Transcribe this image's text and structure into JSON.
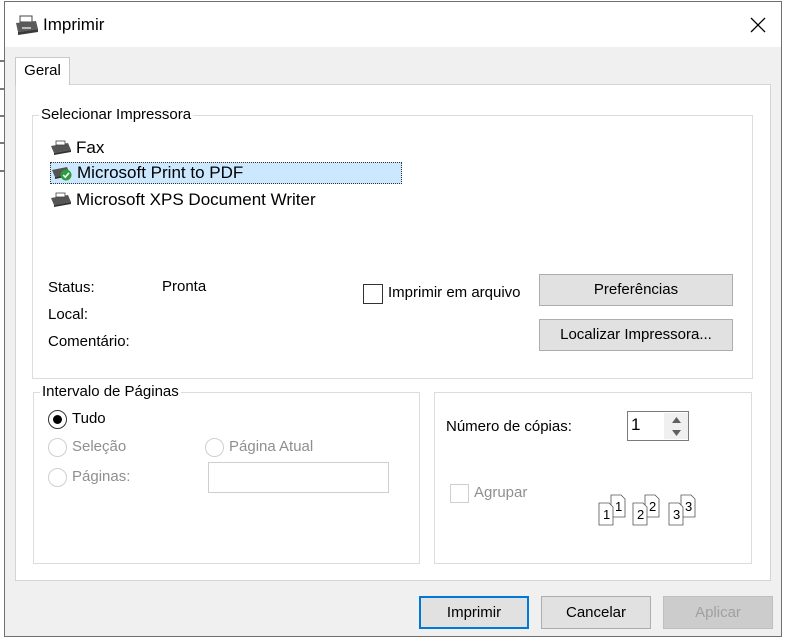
{
  "window": {
    "title": "Imprimir",
    "close_glyph": "✕"
  },
  "tabs": [
    {
      "label": "Geral"
    }
  ],
  "printer_section": {
    "legend": "Selecionar Impressora",
    "printers": [
      {
        "name": "Fax",
        "icon": "fax-icon"
      },
      {
        "name": "Microsoft Print to PDF",
        "icon": "default-printer-icon",
        "selected": true
      },
      {
        "name": "Microsoft XPS Document Writer",
        "icon": "printer-icon"
      }
    ],
    "status_label": "Status:",
    "status_value": "Pronta",
    "local_label": "Local:",
    "comment_label": "Comentário:",
    "print_to_file_label": "Imprimir em arquivo",
    "preferences_label": "Preferências",
    "find_printer_label": "Localizar Impressora..."
  },
  "page_range": {
    "legend": "Intervalo de Páginas",
    "all_label": "Tudo",
    "selection_label": "Seleção",
    "current_page_label": "Página Atual",
    "pages_label": "Páginas:"
  },
  "copies": {
    "label": "Número de cópias:",
    "value": "1",
    "collate_label": "Agrupar",
    "collate_digits": [
      "1",
      "1",
      "2",
      "2",
      "3",
      "3"
    ]
  },
  "buttons": {
    "print": "Imprimir",
    "cancel": "Cancelar",
    "apply": "Aplicar"
  }
}
